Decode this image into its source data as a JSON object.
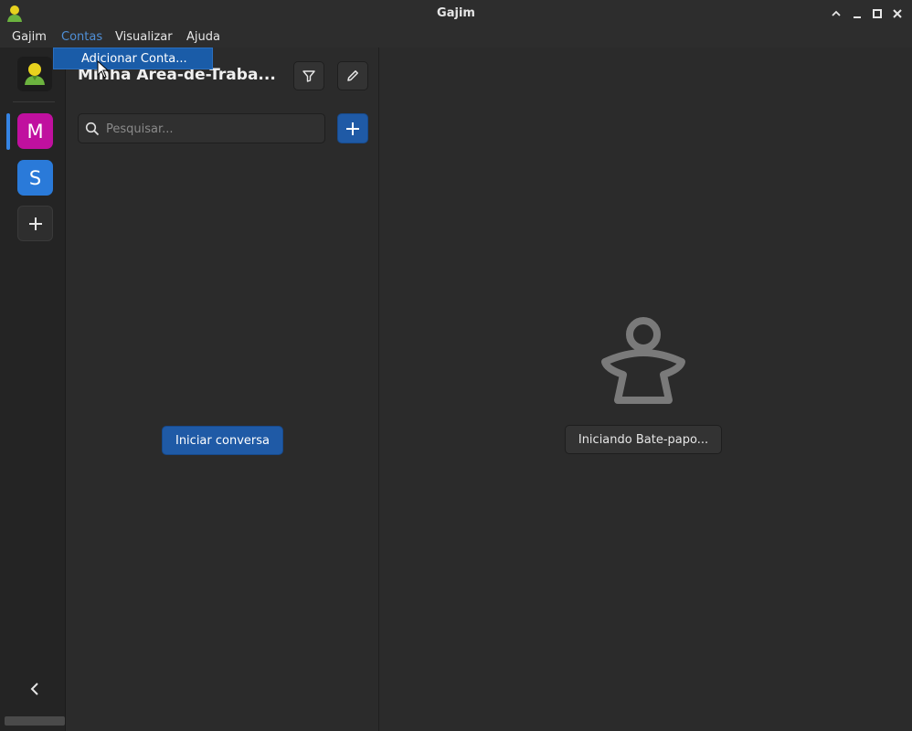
{
  "window": {
    "title": "Gajim"
  },
  "menubar": {
    "items": [
      "Gajim",
      "Contas",
      "Visualizar",
      "Ajuda"
    ],
    "active": "Contas"
  },
  "dropdown": {
    "items": [
      "Adicionar Conta..."
    ]
  },
  "rail": {
    "accounts": [
      {
        "initial": "M",
        "color": "#c0109f"
      },
      {
        "initial": "S",
        "color": "#2a7ad9"
      }
    ]
  },
  "sidepanel": {
    "title": "Minha Área-de-Traba...",
    "search_placeholder": "Pesquisar...",
    "start_chat_label": "Iniciar conversa"
  },
  "main": {
    "status_label": "Iniciando Bate-papo..."
  },
  "colors": {
    "accent": "#1f5aa6",
    "highlight": "#3584e4"
  }
}
